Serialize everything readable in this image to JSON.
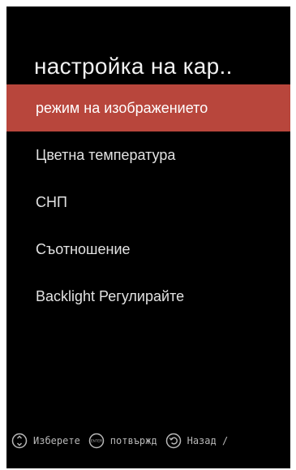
{
  "screen": {
    "title": "настройка на кар.."
  },
  "menu": {
    "items": [
      {
        "label": "режим на изображението",
        "selected": true
      },
      {
        "label": "Цветна температура",
        "selected": false
      },
      {
        "label": "СНП",
        "selected": false
      },
      {
        "label": "Съотношение",
        "selected": false
      },
      {
        "label": "Backlight Регулирайте",
        "selected": false
      }
    ]
  },
  "footer": {
    "select_hint": "Изберете",
    "confirm_hint": "потвържд",
    "back_hint": "Назад /",
    "enter_icon_text": "ENTER"
  },
  "colors": {
    "background": "#000000",
    "highlight": "#b8463c",
    "text": "#e2e2e2"
  },
  "icons": [
    "dpad-icon",
    "enter-icon",
    "back-icon"
  ]
}
